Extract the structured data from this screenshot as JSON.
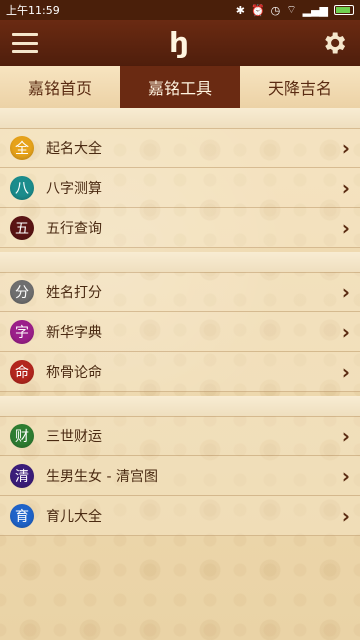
{
  "status": {
    "time": "上午11:59",
    "icons": [
      "bluetooth-icon",
      "alarm-icon",
      "clock-icon",
      "wifi-icon",
      "signal-icon",
      "battery-icon"
    ]
  },
  "topbar": {
    "logo": "ꜧ",
    "menu_icon": "menu-icon",
    "settings_icon": "gear-icon"
  },
  "tabs": [
    {
      "label": "嘉铭首页",
      "active": false
    },
    {
      "label": "嘉铭工具",
      "active": true
    },
    {
      "label": "天降吉名",
      "active": false
    }
  ],
  "sections": [
    {
      "items": [
        {
          "char": "全",
          "label": "起名大全",
          "color": "#e6a21a"
        },
        {
          "char": "八",
          "label": "八字测算",
          "color": "#1b8c8c"
        },
        {
          "char": "五",
          "label": "五行查询",
          "color": "#5a1414"
        }
      ]
    },
    {
      "items": [
        {
          "char": "分",
          "label": "姓名打分",
          "color": "#6f6f6f"
        },
        {
          "char": "字",
          "label": "新华字典",
          "color": "#9b1f8a"
        },
        {
          "char": "命",
          "label": "称骨论命",
          "color": "#b3261e"
        }
      ]
    },
    {
      "items": [
        {
          "char": "财",
          "label": "三世财运",
          "color": "#2e7d32"
        },
        {
          "char": "清",
          "label": "生男生女 - 清宫图",
          "color": "#3b1d7a"
        },
        {
          "char": "育",
          "label": "育儿大全",
          "color": "#1f63c9"
        }
      ]
    }
  ]
}
